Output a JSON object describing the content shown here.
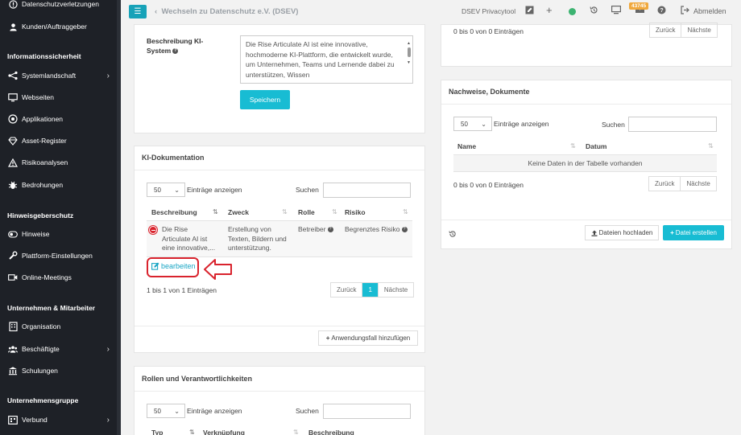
{
  "sidebar": {
    "items_top": [
      {
        "label": "Datenschutzverletzungen",
        "icon": "alert-circle-icon"
      },
      {
        "label": "Kunden/Auftraggeber",
        "icon": "user-icon"
      }
    ],
    "section1": "Informationssicherheit",
    "items_sec1": [
      {
        "label": "Systemlandschaft",
        "icon": "network-icon",
        "chevron": true
      },
      {
        "label": "Webseiten",
        "icon": "monitor-icon"
      },
      {
        "label": "Applikationen",
        "icon": "app-icon"
      },
      {
        "label": "Asset-Register",
        "icon": "diamond-icon"
      },
      {
        "label": "Risikoanalysen",
        "icon": "warning-icon"
      },
      {
        "label": "Bedrohungen",
        "icon": "bug-icon"
      }
    ],
    "section2": "Hinweisgeberschutz",
    "items_sec2": [
      {
        "label": "Hinweise",
        "icon": "toggle-icon"
      },
      {
        "label": "Plattform-Einstellungen",
        "icon": "wrench-icon"
      },
      {
        "label": "Online-Meetings",
        "icon": "video-icon"
      }
    ],
    "section3": "Unternehmen & Mitarbeiter",
    "items_sec3": [
      {
        "label": "Organisation",
        "icon": "building-icon"
      },
      {
        "label": "Beschäftigte",
        "icon": "users-icon",
        "chevron": true
      },
      {
        "label": "Schulungen",
        "icon": "school-icon"
      }
    ],
    "section4": "Unternehmensgruppe",
    "items_sec4": [
      {
        "label": "Verbund",
        "icon": "group-icon",
        "chevron": true
      }
    ]
  },
  "topbar": {
    "breadcrumb": "Wechseln zu Datenschutz e.V. (DSEV)",
    "tool_name": "DSEV Privacytool",
    "badge_count": "43745",
    "logout": "Abmelden"
  },
  "ki_form": {
    "label": "Beschreibung KI-System",
    "label_line1": "Beschreibung KI-",
    "label_line2": "System",
    "textarea_value": "Die Rise Articulate AI ist eine innovative, hochmoderne KI-Plattform, die entwickelt wurde, um Unternehmen, Teams und Lernende dabei zu unterstützen, Wissen",
    "save_label": "Speichern"
  },
  "ki_doc": {
    "title": "KI-Dokumentation",
    "page_size": "50",
    "entries_label": "Einträge anzeigen",
    "search_label": "Suchen",
    "columns": [
      "Beschreibung",
      "Zweck",
      "Rolle",
      "Risiko"
    ],
    "row": {
      "beschreibung": [
        "Die Rise",
        "Articulate AI ist",
        "eine innovative,..."
      ],
      "zweck": [
        "Erstellung von",
        "Texten, Bildern und",
        "unterstützung."
      ],
      "rolle": "Betreiber",
      "risiko": "Begrenztes Risiko"
    },
    "edit_label": "bearbeiten",
    "info": "1 bis 1 von 1 Einträgen",
    "prev": "Zurück",
    "page": "1",
    "next": "Nächste",
    "add_label": "Anwendungsfall hinzufügen"
  },
  "roles": {
    "title": "Rollen und Verantwortlichkeiten",
    "page_size": "50",
    "entries_label": "Einträge anzeigen",
    "search_label": "Suchen",
    "columns": [
      "Typ",
      "Verknüpfung",
      "Beschreibung"
    ]
  },
  "right_top": {
    "info": "0 bis 0 von 0 Einträgen",
    "prev": "Zurück",
    "next": "Nächste"
  },
  "nachweise": {
    "title": "Nachweise, Dokumente",
    "page_size": "50",
    "entries_label": "Einträge anzeigen",
    "search_label": "Suchen",
    "columns": [
      "Name",
      "Datum"
    ],
    "empty": "Keine Daten in der Tabelle vorhanden",
    "info": "0 bis 0 von 0 Einträgen",
    "prev": "Zurück",
    "next": "Nächste",
    "upload_label": "Dateien hochladen",
    "create_label": "Datei erstellen"
  },
  "colors": {
    "sidebar_bg": "#1e2127",
    "accent": "#18bcd3",
    "highlight_red": "#d9232d"
  }
}
